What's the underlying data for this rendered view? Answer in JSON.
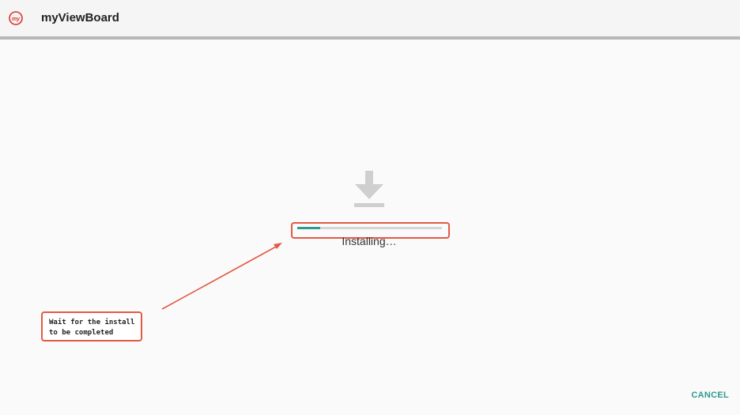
{
  "header": {
    "app_title": "myViewBoard",
    "app_icon": "myviewboard-logo-icon",
    "app_icon_text": "my"
  },
  "install": {
    "status": "Installing…",
    "progress_fraction": 0.16,
    "icon": "download-icon"
  },
  "annotation": {
    "note_line1": "Wait for the install",
    "note_line2": "to be completed"
  },
  "footer": {
    "cancel_label": "CANCEL"
  },
  "colors": {
    "accent": "#2c9b91",
    "callout": "#e25a44",
    "icon_gray": "#cfcfcf",
    "logo_red": "#d9362b"
  }
}
